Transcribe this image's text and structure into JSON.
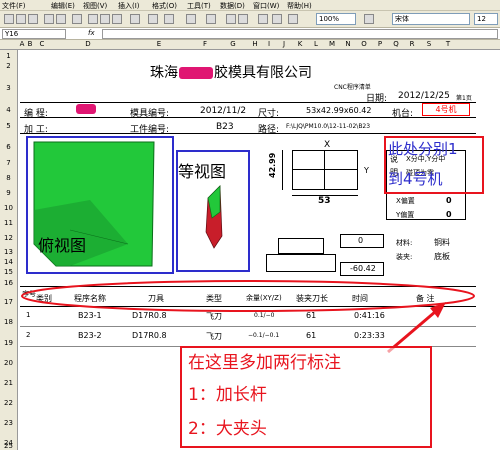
{
  "menu": [
    "文件(F)",
    "编辑(E)",
    "视图(V)",
    "插入(I)",
    "格式(O)",
    "工具(T)",
    "数据(D)",
    "窗口(W)",
    "帮助(H)"
  ],
  "toolbar": {
    "zoom": "100%",
    "font": "宋体",
    "font_size": "12"
  },
  "formula_bar": {
    "cell_ref": "Y16",
    "fx": "fx"
  },
  "columns": [
    "A",
    "B",
    "C",
    "D",
    "E",
    "F",
    "G",
    "H",
    "I",
    "J",
    "K",
    "L",
    "M",
    "N",
    "O",
    "P",
    "Q",
    "R",
    "S",
    "T"
  ],
  "rows": [
    "1",
    "2",
    "3",
    "4",
    "5",
    "6",
    "7",
    "8",
    "9",
    "10",
    "11",
    "12",
    "13",
    "14",
    "15",
    "16",
    "17",
    "18",
    "19",
    "20",
    "21",
    "22",
    "23",
    "24",
    "25"
  ],
  "sheet": {
    "title": "珠海",
    "title_tail": "胶模具有限公司",
    "subtitle": "CNC程序清单",
    "date_label": "日期:",
    "date_value": "2012/12/25",
    "page": "第1页",
    "programmer_label": "编 程:",
    "mold_no_label": "模具编号:",
    "mold_no_value": "2012/11/2",
    "size_label": "尺寸:",
    "size_value": "53x42.99x60.42",
    "machine_label": "机台:",
    "machine_value": "4号机",
    "worker_label": "加 工:",
    "workpiece_label": "工件编号:",
    "workpiece_value": "B23",
    "path_label": "路径:",
    "path_value": "F:\\LJQ\\PM10.0\\12-11-02\\B23",
    "dim_x": "X",
    "dim_y": "Y",
    "dim_h": "42.99",
    "dim_w": "53",
    "dim_z": "0",
    "dim_bottom": "-60.42",
    "x_center": "X分中,Y分中",
    "touch_z": "碰顶为零",
    "x_offset_label": "X偏置",
    "x_offset_value": "0",
    "y_offset_label": "Y偏置",
    "y_offset_value": "0",
    "material_label": "材料:",
    "material_value": "铜料",
    "clamp_label": "装夹:",
    "clamp_value": "底板",
    "note_left_1": "说",
    "note_left_2": "明"
  },
  "table": {
    "headers": [
      "序号",
      "类别",
      "程序名称",
      "刀具",
      "类型",
      "余量(XY/Z)",
      "装夹刀长",
      "时间",
      "备 注"
    ],
    "rows": [
      [
        "1",
        "",
        "B23-1",
        "D17R0.8",
        "飞刀",
        "0.1/−0",
        "61",
        "0:41:16",
        ""
      ],
      [
        "2",
        "",
        "B23-2",
        "D17R0.8",
        "飞刀",
        "−0.1/−0.1",
        "61",
        "0:23:33",
        ""
      ]
    ]
  },
  "annotations": {
    "top_view": "俯视图",
    "iso_view": "等视图",
    "machine_note_1": "此处分别1",
    "machine_note_2": "到4号机",
    "big_note_1": "在这里多加两行标注",
    "big_note_2": "1：加长杆",
    "big_note_3": "2：大夹头"
  },
  "colors": {
    "annot_blue": "#2d2dcc",
    "annot_red": "#e8141e",
    "model_green": "#22c83a",
    "model_red": "#c81e2a"
  }
}
